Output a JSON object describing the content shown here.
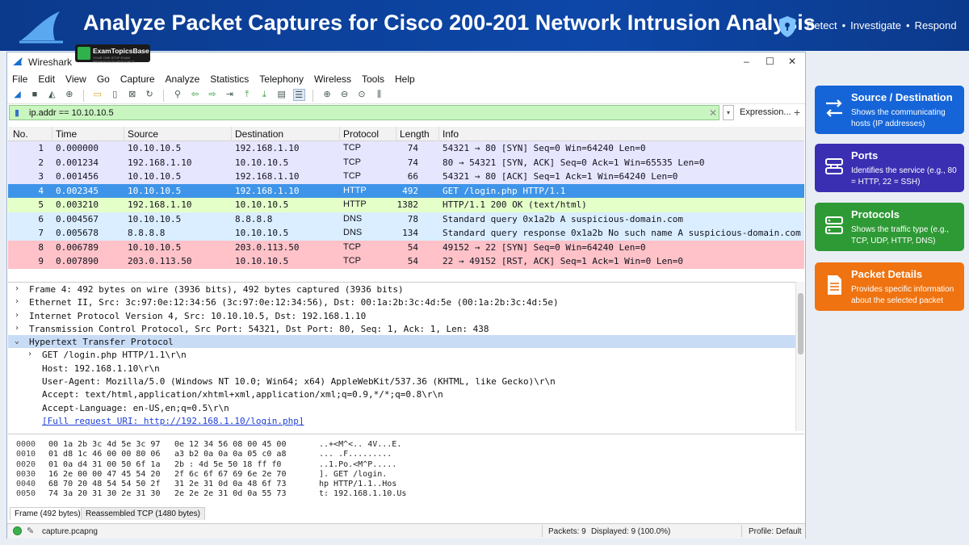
{
  "banner": {
    "title": "Analyze Packet Captures for Cisco 200-201 Network Intrusion Analysis",
    "tagline": [
      "Detect",
      "Investigate",
      "Respond"
    ],
    "tagline_sep": "•"
  },
  "watermark": {
    "name": "ExamTopicsBase",
    "sub": "YOUR ONE-STOP EXAM PREPARATION RESOURCE"
  },
  "window": {
    "title": "Wireshark",
    "controls": [
      "–",
      "☐",
      "✕"
    ]
  },
  "menu": [
    "File",
    "Edit",
    "View",
    "Go",
    "Capture",
    "Analyze",
    "Statistics",
    "Telephony",
    "Wireless",
    "Tools",
    "Help"
  ],
  "filter": {
    "value": "ip.addr == 10.10.10.5",
    "expression_label": "Expression...",
    "clear": "✕",
    "drop": "▾",
    "plus": "+"
  },
  "columns": [
    "No.",
    "Time",
    "Source",
    "Destination",
    "Protocol",
    "Length",
    "Info"
  ],
  "packets": [
    {
      "no": "1",
      "time": "0.000000",
      "src": "10.10.10.5",
      "dst": "192.168.1.10",
      "proto": "TCP",
      "len": "74",
      "info": "54321 → 80  [SYN] Seq=0 Win=64240 Len=0",
      "bg": "#e7e6ff",
      "fg": "#12131f"
    },
    {
      "no": "2",
      "time": "0.001234",
      "src": "192.168.1.10",
      "dst": "10.10.10.5",
      "proto": "TCP",
      "len": "74",
      "info": "80 → 54321  [SYN, ACK] Seq=0 Ack=1 Win=65535 Len=0",
      "bg": "#e7e6ff",
      "fg": "#12131f"
    },
    {
      "no": "3",
      "time": "0.001456",
      "src": "10.10.10.5",
      "dst": "192.168.1.10",
      "proto": "TCP",
      "len": "66",
      "info": "54321 → 80  [ACK] Seq=1 Ack=1 Win=64240 Len=0",
      "bg": "#e7e6ff",
      "fg": "#12131f"
    },
    {
      "no": "4",
      "time": "0.002345",
      "src": "10.10.10.5",
      "dst": "192.168.1.10",
      "proto": "HTTP",
      "len": "492",
      "info": "GET /login.php HTTP/1.1",
      "bg": "#3e94e8",
      "fg": "#ffffff"
    },
    {
      "no": "5",
      "time": "0.003210",
      "src": "192.168.1.10",
      "dst": "10.10.10.5",
      "proto": "HTTP",
      "len": "1382",
      "info": "HTTP/1.1 200 OK  (text/html)",
      "bg": "#e4ffc7",
      "fg": "#12131f"
    },
    {
      "no": "6",
      "time": "0.004567",
      "src": "10.10.10.5",
      "dst": "8.8.8.8",
      "proto": "DNS",
      "len": "78",
      "info": "Standard query 0x1a2b A suspicious-domain.com",
      "bg": "#daeeff",
      "fg": "#12131f"
    },
    {
      "no": "7",
      "time": "0.005678",
      "src": "8.8.8.8",
      "dst": "10.10.10.5",
      "proto": "DNS",
      "len": "134",
      "info": "Standard query response 0x1a2b No such name A suspicious-domain.com",
      "bg": "#daeeff",
      "fg": "#12131f"
    },
    {
      "no": "8",
      "time": "0.006789",
      "src": "10.10.10.5",
      "dst": "203.0.113.50",
      "proto": "TCP",
      "len": "54",
      "info": "49152 → 22 [SYN] Seq=0 Win=64240 Len=0",
      "bg": "#ffc2c8",
      "fg": "#12131f"
    },
    {
      "no": "9",
      "time": "0.007890",
      "src": "203.0.113.50",
      "dst": "10.10.10.5",
      "proto": "TCP",
      "len": "54",
      "info": "22 → 49152 [RST, ACK] Seq=1 Ack=1 Win=0 Len=0",
      "bg": "#ffc2c8",
      "fg": "#12131f"
    }
  ],
  "details": [
    {
      "arrow": "›",
      "text": "Frame 4: 492 bytes on wire (3936 bits), 492 bytes captured (3936 bits)",
      "indent": 0
    },
    {
      "arrow": "›",
      "text": "Ethernet II, Src: 3c:97:0e:12:34:56 (3c:97:0e:12:34:56), Dst: 00:1a:2b:3c:4d:5e (00:1a:2b:3c:4d:5e)",
      "indent": 0
    },
    {
      "arrow": "›",
      "text": "Internet Protocol Version 4, Src: 10.10.10.5, Dst: 192.168.1.10",
      "indent": 0
    },
    {
      "arrow": "›",
      "text": "Transmission Control Protocol, Src Port: 54321, Dst Port: 80, Seq: 1, Ack: 1, Len: 438",
      "indent": 0
    },
    {
      "arrow": "⌄",
      "text": "Hypertext Transfer Protocol",
      "indent": 0,
      "selected": true
    },
    {
      "arrow": "›",
      "text": "GET /login.php HTTP/1.1\\r\\n",
      "indent": 1
    },
    {
      "arrow": "",
      "text": "Host: 192.168.1.10\\r\\n",
      "indent": 1
    },
    {
      "arrow": "",
      "text": "User-Agent: Mozilla/5.0 (Windows NT 10.0; Win64; x64) AppleWebKit/537.36 (KHTML, like Gecko)\\r\\n",
      "indent": 1
    },
    {
      "arrow": "",
      "text": "Accept: text/html,application/xhtml+xml,application/xml;q=0.9,*/*;q=0.8\\r\\n",
      "indent": 1
    },
    {
      "arrow": "",
      "text": "Accept-Language: en-US,en;q=0.5\\r\\n",
      "indent": 1
    },
    {
      "arrow": "",
      "text": "[Full request URI: http://192.168.1.10/login.php]",
      "indent": 1,
      "link": true
    }
  ],
  "hex": [
    {
      "off": "0000",
      "a": "00 1a 2b 3c 4d 5e 3c 97",
      "b": "0e 12 34 56 08 00 45 00",
      "ascii": "..+<M^<.. 4V...E."
    },
    {
      "off": "0010",
      "a": "01 d8 1c 46 00 00 80 06",
      "b": "a3 b2 0a 0a 0a 05 c0 a8",
      "ascii": "... .F........."
    },
    {
      "off": "0020",
      "a": "01 0a d4 31 00 50 6f 1a",
      "b": "2b :  4d 5e 50 18 ff f0",
      "ascii": "..1.Po.<M^P....."
    },
    {
      "off": "0030",
      "a": "16 2e 00 00 47 45 54 20",
      "b": "2f 6c 6f 67 69 6e 2e 70",
      "ascii": "].  GET /login."
    },
    {
      "off": "0040",
      "a": "68 70 20 48 54 54 50 2f",
      "b": "31 2e 31 0d 0a 48 6f 73",
      "ascii": "hp HTTP/1.1..Hos"
    },
    {
      "off": "0050",
      "a": "74 3a 20 31 30 2e 31 30",
      "b": "2e 2e 2e 31 0d 0a 55 73",
      "ascii": "t: 192.168.1.10.Us"
    }
  ],
  "bottom_tabs": [
    "Frame (492 bytes)",
    "Reassembled TCP (1480 bytes)"
  ],
  "status": {
    "file": "capture.pcapng",
    "packets": "Packets: 9",
    "displayed": "Displayed: 9 (100.0%)",
    "profile": "Profile: Default"
  },
  "cards": [
    {
      "title": "Source / Destination",
      "desc": "Shows the communicating hosts (IP addresses)",
      "color": "#1565d8",
      "icon": "swap-arrows-icon"
    },
    {
      "title": "Ports",
      "desc": "Identifies the service (e.g., 80 = HTTP, 22 = SSH)",
      "color": "#3a2fb2",
      "icon": "port-icon"
    },
    {
      "title": "Protocols",
      "desc": "Shows the traffic type (e.g., TCP, UDP, HTTP, DNS)",
      "color": "#2e9a35",
      "icon": "stack-icon"
    },
    {
      "title": "Packet Details",
      "desc": "Provides specific information about the selected packet",
      "color": "#ef7310",
      "icon": "document-icon"
    }
  ]
}
